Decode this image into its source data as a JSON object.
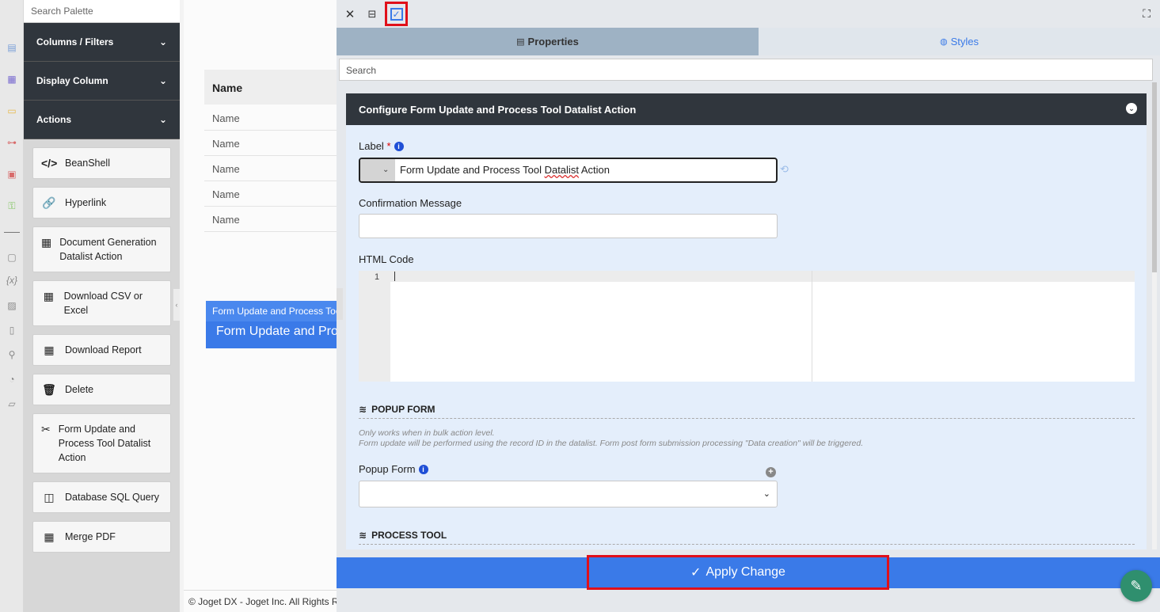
{
  "palette": {
    "search_placeholder": "Search Palette",
    "sections": [
      {
        "label": "Columns / Filters"
      },
      {
        "label": "Display Column"
      },
      {
        "label": "Actions"
      }
    ],
    "items": [
      {
        "label": "BeanShell",
        "icon": "code-icon"
      },
      {
        "label": "Hyperlink",
        "icon": "link-icon"
      },
      {
        "label": "Document Generation Datalist Action",
        "icon": "grid-icon"
      },
      {
        "label": "Download CSV or Excel",
        "icon": "grid-icon"
      },
      {
        "label": "Download Report",
        "icon": "grid-icon"
      },
      {
        "label": "Delete",
        "icon": "trash-icon"
      },
      {
        "label": "Form Update and Process Tool Datalist Action",
        "icon": "tools-icon"
      },
      {
        "label": "Database SQL Query",
        "icon": "database-icon"
      },
      {
        "label": "Merge PDF",
        "icon": "grid-icon"
      }
    ]
  },
  "canvas": {
    "header": "Name",
    "rows": [
      "Name",
      "Name",
      "Name",
      "Name",
      "Name"
    ],
    "action_small": "Form Update and Process Too",
    "action_big": "Form Update and Pro",
    "footer": "© Joget DX - Joget Inc. All Rights R"
  },
  "panel": {
    "tabs": {
      "properties": "Properties",
      "styles": "Styles"
    },
    "search_placeholder": "Search",
    "section_title": "Configure Form Update and Process Tool Datalist Action",
    "label_field": {
      "label": "Label",
      "required": "*",
      "value_prefix": "Form Update and Process Tool ",
      "value_underlined": "Datalist",
      "value_suffix": " Action"
    },
    "confirmation_label": "Confirmation Message",
    "confirmation_value": "",
    "html_code_label": "HTML Code",
    "code_line_number": "1",
    "popup_section": "POPUP FORM",
    "popup_desc_1": "Only works when in bulk action level.",
    "popup_desc_2": "Form update will be performed using the record ID in the datalist. Form post form submission processing \"Data creation\" will be triggered.",
    "popup_form_label": "Popup Form",
    "popup_form_value": "",
    "process_section": "PROCESS TOOL",
    "apply_label": "Apply Change"
  },
  "colors": {
    "accent": "#3a7ae8",
    "dark": "#30363d",
    "highlight": "#e0101a"
  }
}
